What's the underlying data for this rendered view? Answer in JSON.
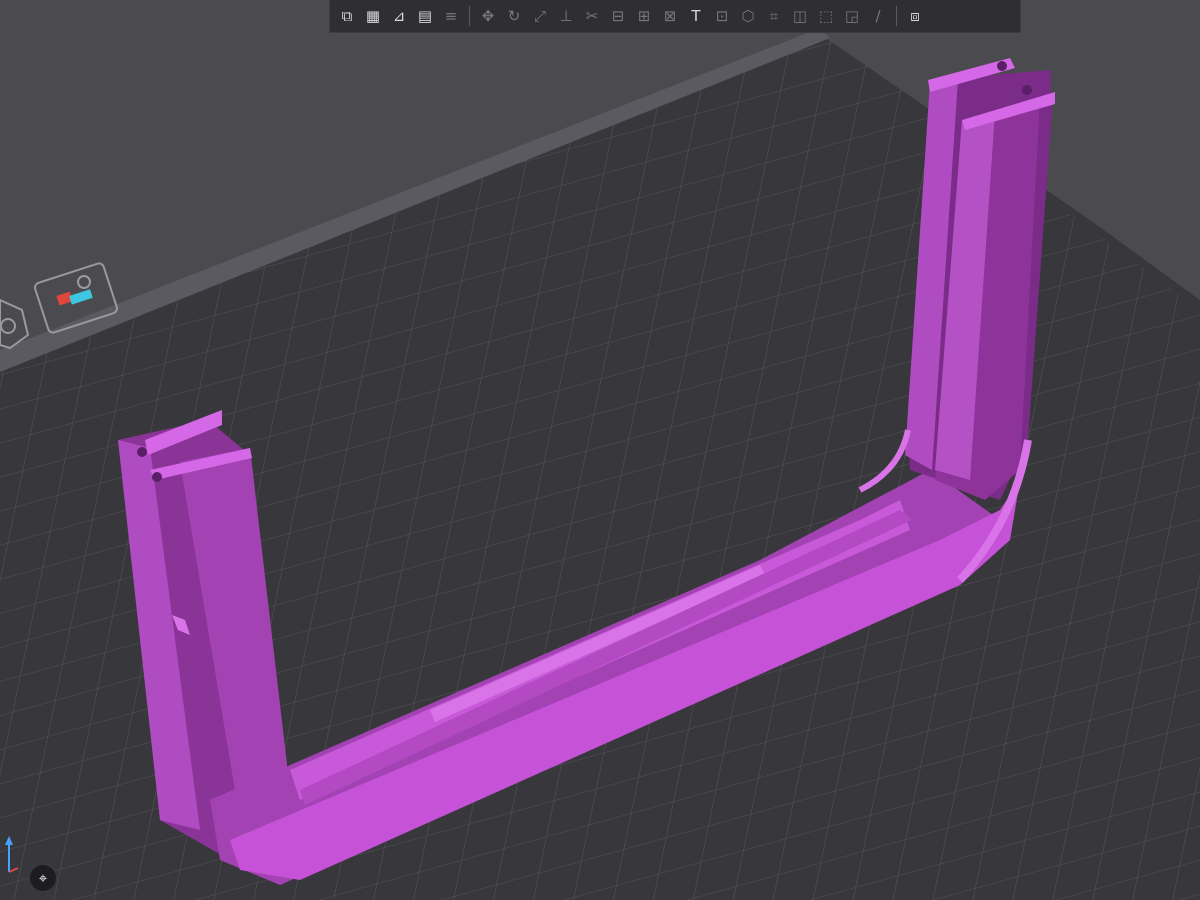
{
  "app": {
    "window": "3D slicer plate view"
  },
  "toolbar": {
    "items": [
      {
        "name": "add-icon",
        "glyph": "⧉",
        "dim": false
      },
      {
        "name": "arrange-icon",
        "glyph": "▦",
        "dim": false
      },
      {
        "name": "orient-icon",
        "glyph": "⊿",
        "dim": false
      },
      {
        "name": "plate-layout-icon",
        "glyph": "▤",
        "dim": false
      },
      {
        "name": "layers-icon",
        "glyph": "≡",
        "dim": true
      },
      {
        "name": "sep",
        "glyph": "",
        "dim": true
      },
      {
        "name": "move-icon",
        "glyph": "✥",
        "dim": true
      },
      {
        "name": "rotate-icon",
        "glyph": "↻",
        "dim": true
      },
      {
        "name": "scale-icon",
        "glyph": "⤢",
        "dim": true
      },
      {
        "name": "lay-flat-icon",
        "glyph": "⊥",
        "dim": true
      },
      {
        "name": "cut-icon",
        "glyph": "✂",
        "dim": true
      },
      {
        "name": "support-paint-icon",
        "glyph": "⊟",
        "dim": true
      },
      {
        "name": "seam-paint-icon",
        "glyph": "⊞",
        "dim": true
      },
      {
        "name": "color-paint-icon",
        "glyph": "⊠",
        "dim": true
      },
      {
        "name": "text-icon",
        "glyph": "T",
        "dim": false
      },
      {
        "name": "measure-icon",
        "glyph": "⊡",
        "dim": true
      },
      {
        "name": "assembly-icon",
        "glyph": "⬡",
        "dim": true
      },
      {
        "name": "split-icon",
        "glyph": "⌗",
        "dim": true
      },
      {
        "name": "boolean-icon",
        "glyph": "◫",
        "dim": true
      },
      {
        "name": "emboss-icon",
        "glyph": "⬚",
        "dim": true
      },
      {
        "name": "hollow-icon",
        "glyph": "◲",
        "dim": true
      },
      {
        "name": "drill-icon",
        "glyph": "∕",
        "dim": true
      },
      {
        "name": "sep",
        "glyph": "",
        "dim": true
      },
      {
        "name": "view-settings-icon",
        "glyph": "⧈",
        "dim": false
      }
    ]
  },
  "colors": {
    "background": "#4a494e",
    "bed": "#3a393e",
    "grid": "#55545a",
    "model": "#c652d8",
    "model_dark": "#7e2d8a",
    "model_face": "#a042b3"
  },
  "fit_view": {
    "glyph": "⌖"
  }
}
